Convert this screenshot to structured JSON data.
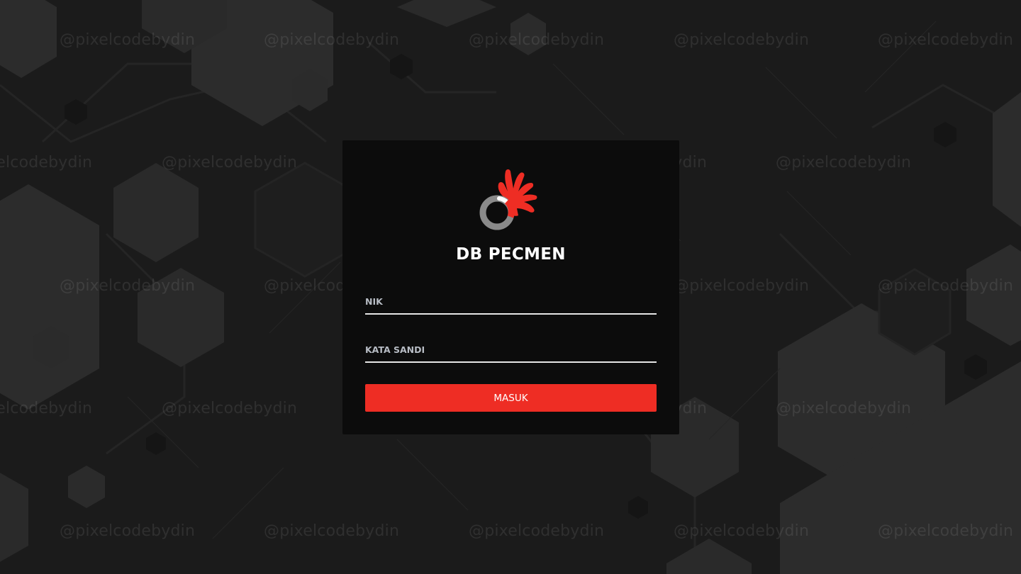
{
  "app": {
    "title": "DB PECMEN"
  },
  "logo": {
    "icon": "hand-ring-logo",
    "colors": {
      "hand": "#ee2d24",
      "ring": "#8a8a8a"
    }
  },
  "form": {
    "nik_label": "NIK",
    "nik_value": "",
    "password_label": "KATA SANDI",
    "password_value": "",
    "submit_label": "MASUK"
  },
  "watermark": {
    "text": "@pixelcodebydin"
  },
  "colors": {
    "background": "#1b1b1b",
    "card": "#0c0c0c",
    "accent": "#ee2d24",
    "hexagon": "#2c2c2c"
  }
}
